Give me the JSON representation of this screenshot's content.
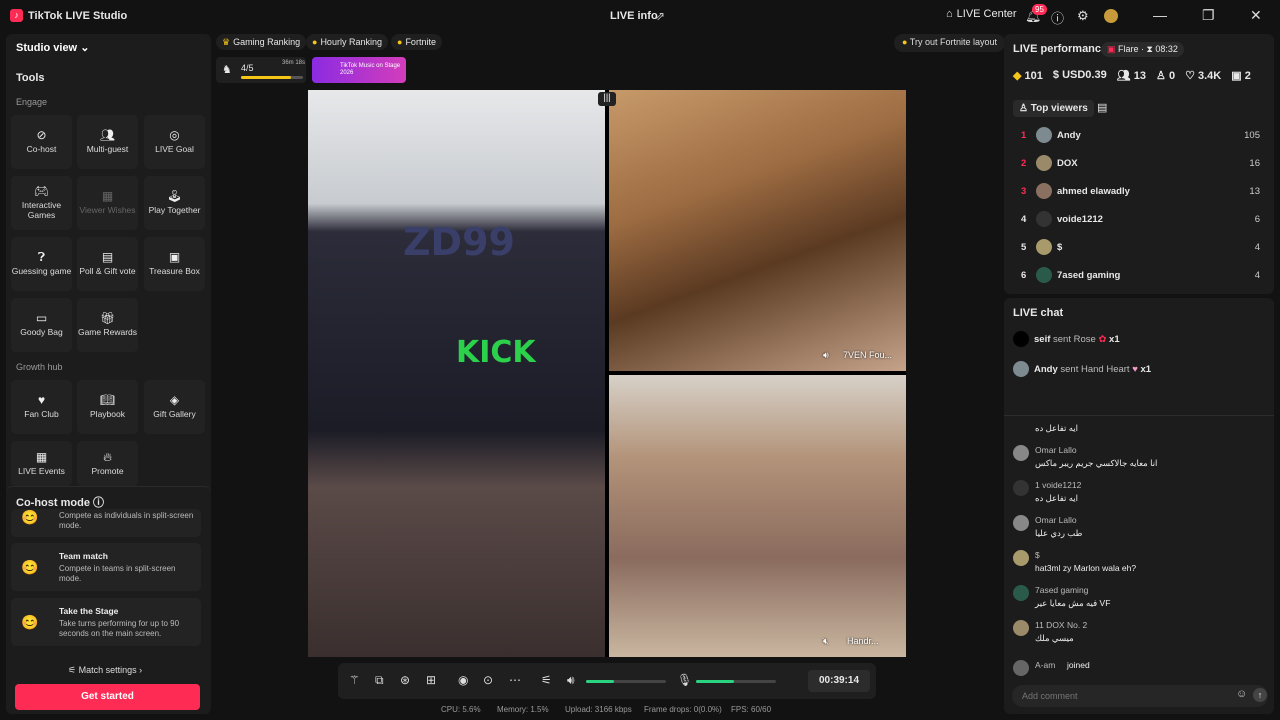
{
  "titlebar": {
    "app_title": "TikTok LIVE Studio",
    "center_title": "LIVE info",
    "live_center": "LIVE Center",
    "notif_count": "95"
  },
  "left": {
    "studio_view": "Studio view",
    "tools": "Tools",
    "engage": "Engage",
    "growth_hub": "Growth hub",
    "engage_tiles": [
      {
        "label": "Co-host",
        "icon": "link-icon"
      },
      {
        "label": "Multi-guest",
        "icon": "people-icon"
      },
      {
        "label": "LIVE Goal",
        "icon": "goal-icon"
      },
      {
        "label": "Interactive Games",
        "icon": "gamepad-icon"
      },
      {
        "label": "Viewer Wishes",
        "icon": "wish-icon"
      },
      {
        "label": "Play Together",
        "icon": "joystick-icon"
      },
      {
        "label": "Guessing game",
        "icon": "question-icon"
      },
      {
        "label": "Poll & Gift vote",
        "icon": "poll-icon"
      },
      {
        "label": "Treasure Box",
        "icon": "box-icon"
      },
      {
        "label": "Goody Bag",
        "icon": "bag-icon"
      },
      {
        "label": "Game Rewards",
        "icon": "reward-icon"
      }
    ],
    "growth_tiles": [
      {
        "label": "Fan Club",
        "icon": "heart-icon"
      },
      {
        "label": "Playbook",
        "icon": "book-icon"
      },
      {
        "label": "Gift Gallery",
        "icon": "gift-icon"
      },
      {
        "label": "LIVE Events",
        "icon": "calendar-icon"
      },
      {
        "label": "Promote",
        "icon": "flame-icon"
      }
    ],
    "cohost_mode": "Co-host mode",
    "card1_desc": "Compete as individuals in split-screen mode.",
    "team_match": "Team match",
    "team_match_desc": "Compete in teams in split-screen mode.",
    "take_stage": "Take the Stage",
    "take_stage_desc": "Take turns performing for up to 90 seconds on the main screen.",
    "match_settings": "Match settings",
    "get_started": "Get started"
  },
  "strip": {
    "gaming_ranking": "Gaming Ranking",
    "hourly_ranking": "Hourly Ranking",
    "fortnite": "Fortnite",
    "rank_count": "4/5",
    "rank_time": "36m 18s",
    "rank_progress": 0.8,
    "promo": "TikTok Music on Stage 2026",
    "try_layout": "Try out Fortnite layout"
  },
  "video": {
    "zd": "ZD99",
    "kick": "KICK",
    "label2": "7VEN Fou...",
    "label3": "Handr..."
  },
  "controls": {
    "timer": "00:39:14",
    "volume": 0.35,
    "mic": 0.48
  },
  "stats": {
    "cpu": "CPU:  5.6%",
    "memory": "Memory:  1.5%",
    "upload": "Upload:  3166 kbps",
    "frame_drops": "Frame drops:  0(0.0%)",
    "fps": "FPS:  60/60"
  },
  "perf": {
    "title": "LIVE performance",
    "flare": "Flare",
    "flare_time": "08:32",
    "diamonds": "101",
    "usd": "USD0.39",
    "viewers": "13",
    "shares": "0",
    "likes": "3.4K",
    "gifts": "2"
  },
  "top_viewers": {
    "label": "Top viewers",
    "rows": [
      {
        "rank": "1",
        "name": "Andy",
        "score": "105"
      },
      {
        "rank": "2",
        "name": "DOX",
        "score": "16"
      },
      {
        "rank": "3",
        "name": "ahmed elawadly",
        "score": "13"
      },
      {
        "rank": "4",
        "name": "voide1212",
        "score": "6"
      },
      {
        "rank": "5",
        "name": "$",
        "score": "4"
      },
      {
        "rank": "6",
        "name": "7ased gaming",
        "score": "4"
      }
    ]
  },
  "chat": {
    "title": "LIVE chat",
    "gift1_user": "seif",
    "gift1_text": "sent Rose",
    "gift1_count": "x1",
    "gift2_user": "Andy",
    "gift2_text": "sent Hand Heart",
    "gift2_count": "x1",
    "messages": [
      {
        "user": "",
        "text": "ايه تفاعل ده"
      },
      {
        "user": "Omar Lallo",
        "text": "انا معايه جالاكسي جريم ريبر ماكس"
      },
      {
        "user": "1 voide1212",
        "text": "ايه تفاعل ده"
      },
      {
        "user": "Omar Lallo",
        "text": "طب ردي عليا"
      },
      {
        "user": "$",
        "text": "hat3ml zy Marlon wala eh?"
      },
      {
        "user": "7ased gaming",
        "text": "فيه مش معايا عير VF"
      },
      {
        "user": "11 DOX No. 2",
        "text": "ميسي ملك"
      },
      {
        "user": "A-am",
        "text": "joined"
      }
    ],
    "comment_placeholder": "Add comment"
  }
}
